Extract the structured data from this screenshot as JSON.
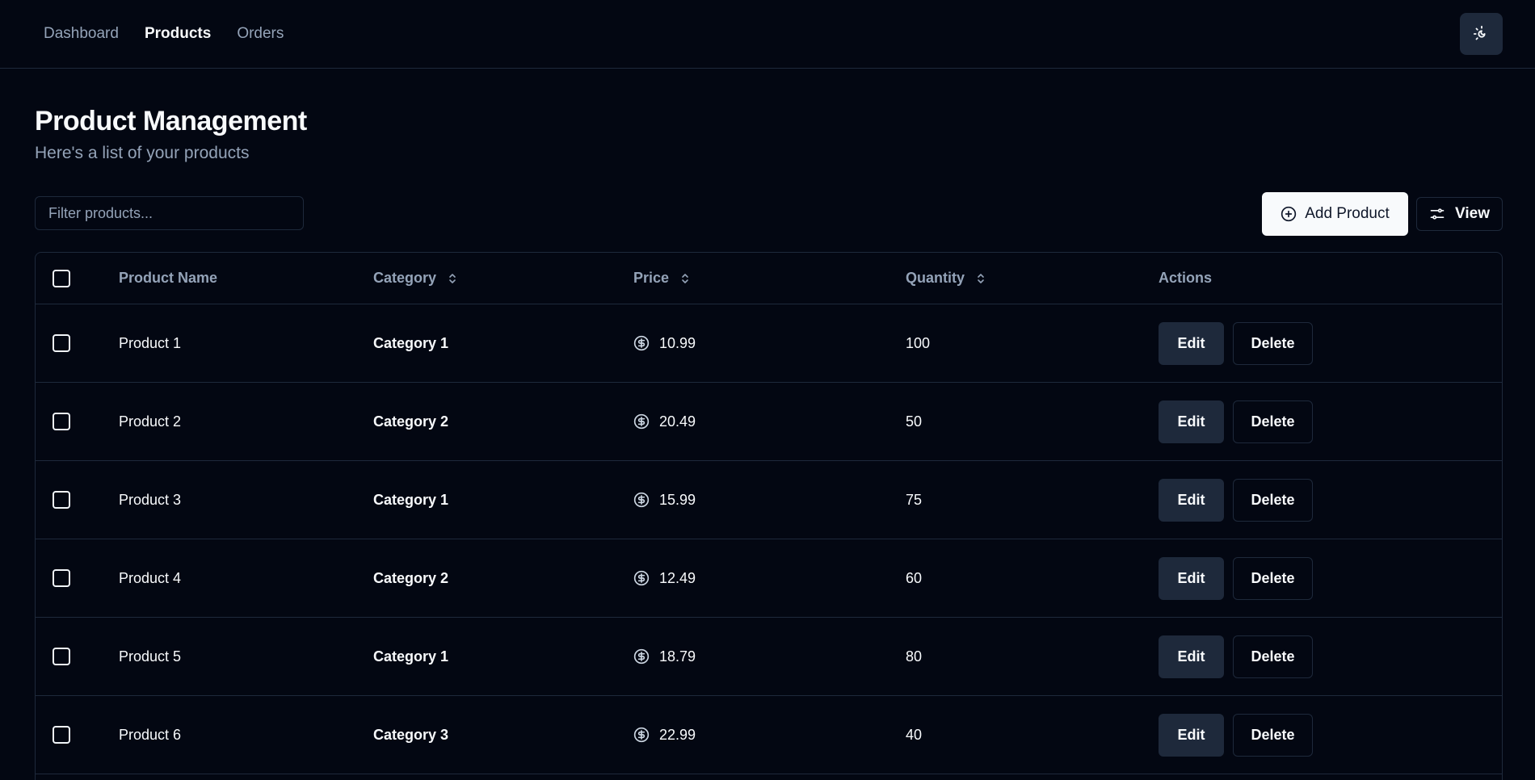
{
  "nav": {
    "links": [
      {
        "label": "Dashboard",
        "active": false
      },
      {
        "label": "Products",
        "active": true
      },
      {
        "label": "Orders",
        "active": false
      }
    ],
    "theme_toggle_icon": "moon-sun-icon"
  },
  "page": {
    "title": "Product Management",
    "subtitle": "Here's a list of your products"
  },
  "toolbar": {
    "filter_placeholder": "Filter products...",
    "filter_value": "",
    "add_label": "Add Product",
    "add_icon": "plus-circle-icon",
    "view_label": "View",
    "view_icon": "sliders-icon"
  },
  "table": {
    "columns": {
      "name": "Product Name",
      "category": "Category",
      "price": "Price",
      "quantity": "Quantity",
      "actions": "Actions"
    },
    "rows": [
      {
        "name": "Product 1",
        "category": "Category 1",
        "price": "10.99",
        "quantity": "100"
      },
      {
        "name": "Product 2",
        "category": "Category 2",
        "price": "20.49",
        "quantity": "50"
      },
      {
        "name": "Product 3",
        "category": "Category 1",
        "price": "15.99",
        "quantity": "75"
      },
      {
        "name": "Product 4",
        "category": "Category 2",
        "price": "12.49",
        "quantity": "60"
      },
      {
        "name": "Product 5",
        "category": "Category 1",
        "price": "18.79",
        "quantity": "80"
      },
      {
        "name": "Product 6",
        "category": "Category 3",
        "price": "22.99",
        "quantity": "40"
      }
    ],
    "edit_label": "Edit",
    "delete_label": "Delete",
    "price_icon": "dollar-circle-icon"
  },
  "colors": {
    "background": "#030712",
    "border": "#1e293b",
    "muted_text": "#94a3b8",
    "primary_text": "#f8fafc"
  }
}
